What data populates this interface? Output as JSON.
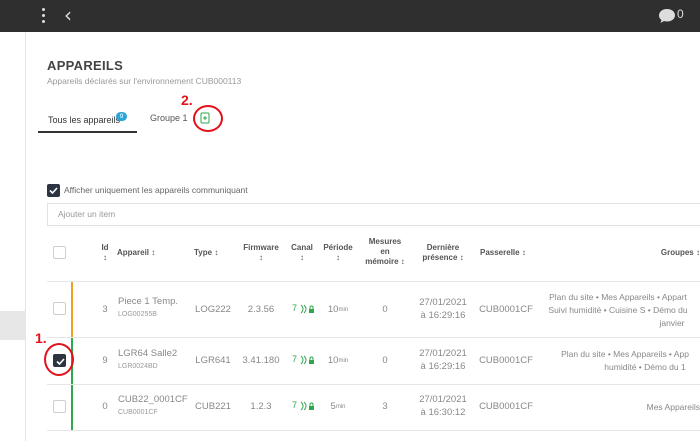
{
  "topbar": {
    "chat_count": "0"
  },
  "header": {
    "title": "APPAREILS",
    "subtitle": "Appareils déclarés sur l'environnement CUB000113"
  },
  "tabs": [
    {
      "label": "Tous les appareils",
      "badge": "9"
    },
    {
      "label": "Groupe 1"
    }
  ],
  "annotations": {
    "first": "1.",
    "second": "2."
  },
  "filter": {
    "label": "Afficher uniquement les appareils communiquant",
    "checked": true
  },
  "search": {
    "placeholder": "Ajouter un item"
  },
  "table": {
    "columns": {
      "id": "Id",
      "appareil": "Appareil",
      "type": "Type",
      "firmware": "Firmware",
      "canal": "Canal",
      "periode": "Période",
      "mesures_line1": "Mesures",
      "mesures_line2": "en",
      "mesures_line3": "mémoire",
      "presence_line1": "Dernière",
      "presence_line2": "présence",
      "passerelle": "Passerelle",
      "groupes": "Groupes"
    },
    "sort_glyph": "↕",
    "rows": [
      {
        "checked": false,
        "status_color": "#f0a020",
        "id": "3",
        "name": "Piece 1 Temp.",
        "serial": "LOG00255B",
        "type": "LOG222",
        "firmware": "2.3.56",
        "canal": "7",
        "periode": "10",
        "periode_unit": "min",
        "mesures": "0",
        "date": "27/01/2021",
        "time": "à 16:29:16",
        "passerelle": "CUB0001CF",
        "groupes_line1": "Plan du site • Mes Appareils • Appart",
        "groupes_line2": "Suivi humidité • Cuisine S • Démo du",
        "groupes_line3": "janvier"
      },
      {
        "checked": true,
        "status_color": "#2fa64e",
        "id": "9",
        "name": "LGR64 Salle2",
        "serial": "LGR0024BD",
        "type": "LGR641",
        "firmware": "3.41.180",
        "canal": "7",
        "periode": "10",
        "periode_unit": "min",
        "mesures": "0",
        "date": "27/01/2021",
        "time": "à 16:29:16",
        "passerelle": "CUB0001CF",
        "groupes_line1": "Plan du site • Mes Appareils • App",
        "groupes_line2": "humidité • Démo du 1",
        "groupes_line3": ""
      },
      {
        "checked": false,
        "status_color": "#2fa64e",
        "id": "0",
        "name": "CUB22_0001CF",
        "serial": "CUB0001CF",
        "type": "CUB221",
        "firmware": "1.2.3",
        "canal": "7",
        "periode": "5",
        "periode_unit": "min",
        "mesures": "3",
        "date": "27/01/2021",
        "time": "à 16:30:12",
        "passerelle": "CUB0001CF",
        "groupes_line1": "Mes Appareils",
        "groupes_line2": "",
        "groupes_line3": ""
      }
    ]
  }
}
